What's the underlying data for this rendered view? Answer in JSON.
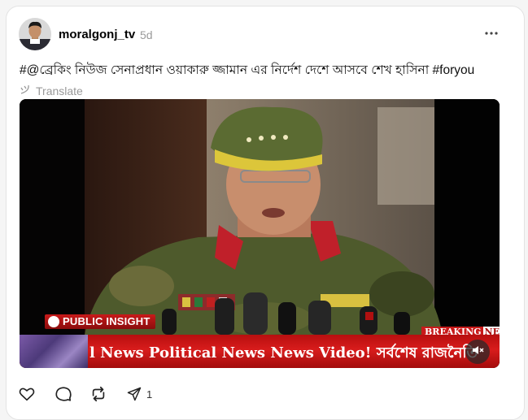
{
  "post": {
    "username": "moralgonj_tv",
    "time": "5d",
    "caption": "#@ব্রেকিং নিউজ সেনাপ্রধান ওয়াকারু জ্জামান এর নির্দেশ দেশে আসবে শেখ হাসিনা #foryou",
    "translate_label": "Translate",
    "translate_icon": "translate-icon"
  },
  "video": {
    "channel_brand": "PUBLIC INSIGHT",
    "breaking_label": "BREAKING",
    "breaking_news": "NEWS",
    "ticker_text": "l News Political News News Video! সর্বশেষ রাজনৈতি",
    "mute_icon": "speaker-muted-icon"
  },
  "actions": {
    "like_icon": "heart-icon",
    "comment_icon": "comment-icon",
    "repost_icon": "repost-icon",
    "share_icon": "send-icon",
    "share_count": "1"
  },
  "colors": {
    "accent_red": "#c81a1a",
    "muted_text": "#999999",
    "card_border": "#e3e3e3"
  }
}
